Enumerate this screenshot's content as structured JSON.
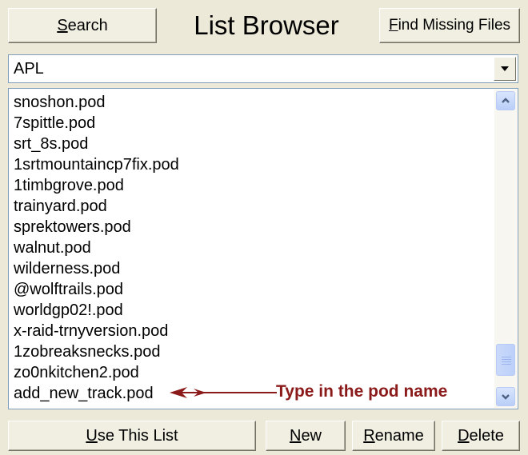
{
  "header": {
    "title": "List Browser",
    "search_label": "Search",
    "search_accel": "S",
    "find_missing_label": "Find Missing Files",
    "find_missing_accel": "F"
  },
  "list_selector": {
    "value": "APL"
  },
  "list": {
    "items": [
      "snoshon.pod",
      "7spittle.pod",
      "srt_8s.pod",
      "1srtmountaincp7fix.pod",
      "1timbgrove.pod",
      "trainyard.pod",
      "sprektowers.pod",
      "walnut.pod",
      "wilderness.pod",
      "@wolftrails.pod",
      "worldgp02!.pod",
      "x-raid-trnyversion.pod",
      "1zobreaksnecks.pod",
      "zo0nkitchen2.pod",
      "add_new_track.pod"
    ],
    "scroll_position": 0.9
  },
  "annotation": {
    "text": "Type in the pod name",
    "color": "#8b1a1a"
  },
  "footer": {
    "use_list_label": "Use This List",
    "use_list_accel": "U",
    "new_label": "New",
    "new_accel": "N",
    "rename_label": "Rename",
    "rename_accel": "R",
    "delete_label": "Delete",
    "delete_accel": "D"
  },
  "icons": {
    "dropdown": "chevron-down-icon",
    "scroll_up": "scroll-up-icon",
    "scroll_down": "scroll-down-icon",
    "annotation_arrow": "arrow-left-icon"
  },
  "colors": {
    "window_bg": "#ece9d8",
    "border_blue": "#7f9db9",
    "scrollbar_blue": "#4d6185"
  }
}
